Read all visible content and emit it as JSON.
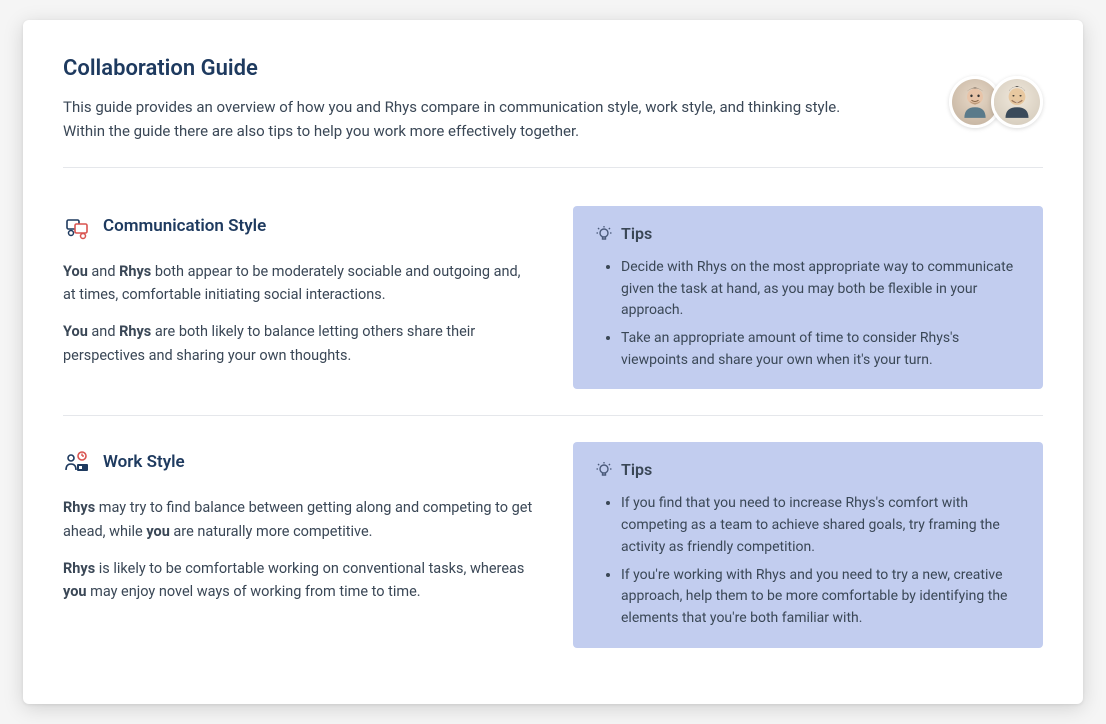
{
  "header": {
    "title": "Collaboration Guide",
    "subtitle": "This guide provides an overview of how you and Rhys compare in communication style, work style, and thinking style. Within the guide there are also tips to help you work more effectively together."
  },
  "sections": [
    {
      "title": "Communication Style",
      "paragraphs": [
        {
          "prefix_bold1": "You",
          "mid1": " and ",
          "bold2": "Rhys",
          "rest": " both appear to be moderately sociable and outgoing and, at times, comfortable initiating social interactions."
        },
        {
          "prefix_bold1": "You",
          "mid1": " and ",
          "bold2": "Rhys",
          "rest": " are both likely to balance letting others share their perspectives and sharing your own thoughts."
        }
      ],
      "tips_label": "Tips",
      "tips": [
        "Decide with Rhys on the most appropriate way to communicate given the task at hand, as you may both be flexible in your approach.",
        "Take an appropriate amount of time to consider Rhys's viewpoints and share your own when it's your turn."
      ]
    },
    {
      "title": "Work Style",
      "paragraphs": [
        {
          "prefix_bold1": "Rhys",
          "mid1": " may try to find balance between getting along and competing to get ahead, while ",
          "bold2": "you",
          "rest": " are naturally more competitive."
        },
        {
          "prefix_bold1": "Rhys",
          "mid1": " is likely to be comfortable working on conventional tasks, whereas ",
          "bold2": "you",
          "rest": " may enjoy novel ways of working from time to time."
        }
      ],
      "tips_label": "Tips",
      "tips": [
        "If you find that you need to increase Rhys's comfort with competing as a team to achieve shared goals, try framing the activity as friendly competition.",
        "If you're working with Rhys and you need to try a new, creative approach, help them to be more comfortable by identifying the elements that you're both familiar with."
      ]
    }
  ]
}
